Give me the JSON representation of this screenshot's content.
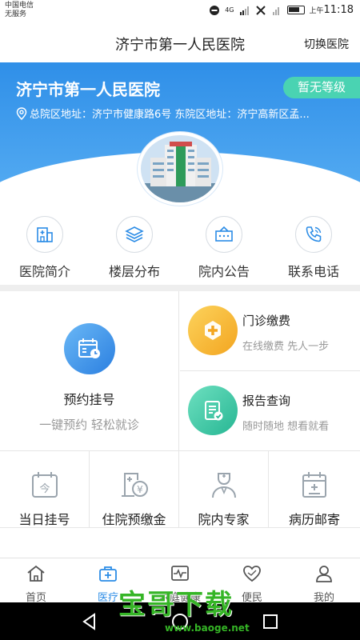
{
  "status_bar": {
    "carrier_line1": "中国电信",
    "carrier_line2": "无服务",
    "network": "4G",
    "time_prefix": "上午",
    "time": "11:18"
  },
  "header": {
    "title": "济宁市第一人民医院",
    "switch_label": "切换医院"
  },
  "banner": {
    "hospital_name": "济宁市第一人民医院",
    "grade": "暂无等级",
    "address": "总院区地址：济宁市健康路6号 东院区地址：济宁高新区孟...",
    "accent_color": "#3b95ea",
    "grade_color": "#4ad3b2"
  },
  "quick_items": [
    {
      "label": "医院简介",
      "icon": "hospital-building-icon"
    },
    {
      "label": "楼层分布",
      "icon": "layers-icon"
    },
    {
      "label": "院内公告",
      "icon": "notice-box-icon"
    },
    {
      "label": "联系电话",
      "icon": "phone-icon"
    }
  ],
  "features": {
    "appointment": {
      "title": "预约挂号",
      "subtitle": "一键预约 轻松就诊",
      "icon": "calendar-clock-icon",
      "color": "#3f9bf0"
    },
    "payment": {
      "title": "门诊缴费",
      "subtitle": "在线缴费 先人一步",
      "icon": "plus-cross-icon",
      "color": "#f7b932"
    },
    "report": {
      "title": "报告查询",
      "subtitle": "随时随地 想看就看",
      "icon": "report-check-icon",
      "color": "#3ac9a6"
    }
  },
  "grid_items": [
    {
      "label": "当日挂号",
      "icon": "calendar-today-icon"
    },
    {
      "label": "住院预缴金",
      "icon": "deposit-icon"
    },
    {
      "label": "院内专家",
      "icon": "doctor-icon"
    },
    {
      "label": "病历邮寄",
      "icon": "medical-record-icon"
    }
  ],
  "tabs": [
    {
      "label": "首页",
      "icon": "home-icon"
    },
    {
      "label": "医疗",
      "icon": "medical-kit-icon",
      "active": true
    },
    {
      "label": "家庭健康",
      "icon": "heartbeat-icon"
    },
    {
      "label": "便民",
      "icon": "heart-hands-icon"
    },
    {
      "label": "我的",
      "icon": "user-icon"
    }
  ],
  "watermark": {
    "main": "宝哥下载",
    "url": "www.baoge.net"
  }
}
